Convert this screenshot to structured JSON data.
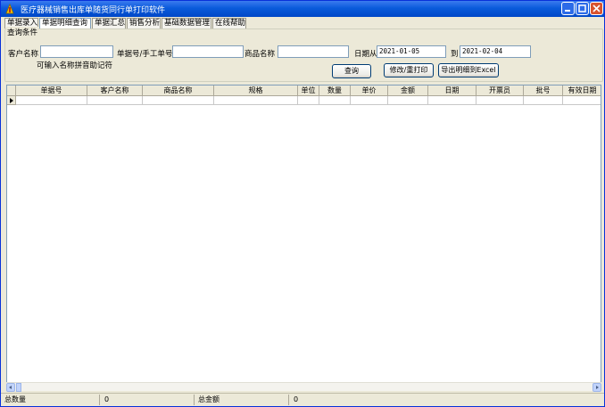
{
  "window": {
    "title": "医疗器械销售出库单随货同行单打印软件"
  },
  "tabs": [
    {
      "label": "单据录入",
      "active": false
    },
    {
      "label": "单据明细查询",
      "active": true
    },
    {
      "label": "单据汇总",
      "active": false
    },
    {
      "label": "销售分析",
      "active": false
    },
    {
      "label": "基础数据管理",
      "active": false
    },
    {
      "label": "在线帮助",
      "active": false
    }
  ],
  "query": {
    "group_title": "查询条件",
    "customer_label": "客户名称",
    "customer_value": "",
    "customer_hint": "可输入名称拼音助记符",
    "doc_no_label": "单据号/手工单号",
    "doc_no_value": "",
    "product_label": "商品名称",
    "product_value": "",
    "date_from_label": "日期从",
    "date_from_value": "2021-01-05",
    "date_to_label": "到",
    "date_to_value": "2021-02-04",
    "search_button": "查询",
    "edit_print_button": "修改/重打印",
    "export_button": "导出明细到Excel"
  },
  "grid": {
    "columns": [
      "单据号",
      "客户名称",
      "商品名称",
      "规格",
      "单位",
      "数量",
      "单价",
      "金额",
      "日期",
      "开票员",
      "批号",
      "有效日期"
    ]
  },
  "status": {
    "total_qty_label": "总数量",
    "total_qty_value": "0",
    "total_amount_label": "总金额",
    "total_amount_value": "0"
  },
  "colors": {
    "titlebar": "#0A5BDB",
    "window_bg": "#ECE9D8",
    "close_button": "#D8542F"
  }
}
